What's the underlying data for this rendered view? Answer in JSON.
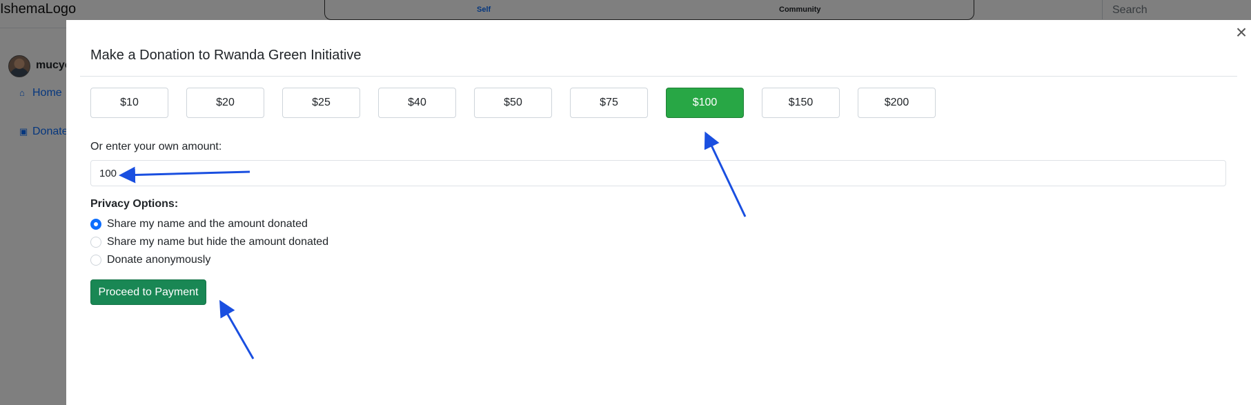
{
  "app": {
    "logo_text": "IshemaLogo",
    "tabs": [
      "Self",
      "Community"
    ],
    "search_placeholder": "Search",
    "username": "mucyo",
    "sidebar": [
      {
        "label": "Home",
        "icon": "home-icon"
      },
      {
        "label": "Donate",
        "icon": "donate-icon"
      }
    ]
  },
  "modal": {
    "title": "Make a Donation to Rwanda Green Initiative",
    "close_icon": "close-icon",
    "preset_amounts": [
      "$10",
      "$20",
      "$25",
      "$40",
      "$50",
      "$75",
      "$100",
      "$150",
      "$200"
    ],
    "selected_amount": "$100",
    "own_amount_label": "Or enter your own amount:",
    "own_amount_value": "100",
    "privacy_title": "Privacy Options:",
    "privacy_options": [
      {
        "label": "Share my name and the amount donated",
        "checked": true
      },
      {
        "label": "Share my name but hide the amount donated",
        "checked": false
      },
      {
        "label": "Donate anonymously",
        "checked": false
      }
    ],
    "proceed_label": "Proceed to Payment"
  },
  "colors": {
    "selected_amount_bg": "#28a745",
    "proceed_bg": "#198754",
    "radio_checked": "#0d6efd",
    "annotation_arrow": "#1a4fe0"
  }
}
